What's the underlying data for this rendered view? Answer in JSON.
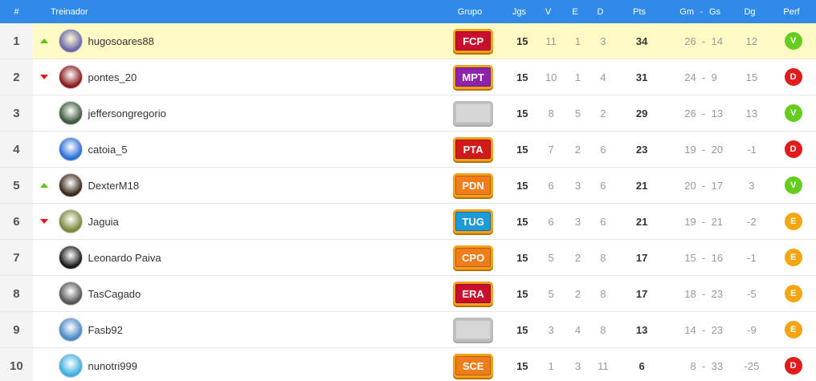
{
  "header": {
    "pos": "#",
    "coach": "Treinador",
    "group": "Grupo",
    "jgs": "Jgs",
    "v": "V",
    "e": "E",
    "d": "D",
    "pts": "Pts",
    "gm": "Gm",
    "dash": "-",
    "gs": "Gs",
    "dg": "Dg",
    "perf": "Perf"
  },
  "colors": {
    "header_bg": "#2f8ae8",
    "highlight_row": "#fff9c4",
    "perf_V": "#66cc1f",
    "perf_D": "#e31b1b",
    "perf_E": "#f5a512"
  },
  "rows": [
    {
      "pos": "1",
      "trend": "up",
      "name": "hugosoares88",
      "avatar_color": "#6a6aa8",
      "group": "FCP",
      "group_color": "#c8102e",
      "jgs": "15",
      "v": "11",
      "e": "1",
      "d": "3",
      "pts": "34",
      "gm": "26",
      "dash": "-",
      "gs": "14",
      "dg": "12",
      "perf": "V",
      "highlight": true
    },
    {
      "pos": "2",
      "trend": "down",
      "name": "pontes_20",
      "avatar_color": "#8b1a1a",
      "group": "MPT",
      "group_color": "#8e24aa",
      "jgs": "15",
      "v": "10",
      "e": "1",
      "d": "4",
      "pts": "31",
      "gm": "24",
      "dash": "-",
      "gs": "9",
      "dg": "15",
      "perf": "D"
    },
    {
      "pos": "3",
      "trend": "",
      "name": "jeffersongregorio",
      "avatar_color": "#3d5a3d",
      "group": "",
      "group_color": "",
      "jgs": "15",
      "v": "8",
      "e": "5",
      "d": "2",
      "pts": "29",
      "gm": "26",
      "dash": "-",
      "gs": "13",
      "dg": "13",
      "perf": "V"
    },
    {
      "pos": "4",
      "trend": "",
      "name": "catoia_5",
      "avatar_color": "#2a6fd6",
      "group": "PTA",
      "group_color": "#d21a1a",
      "jgs": "15",
      "v": "7",
      "e": "2",
      "d": "6",
      "pts": "23",
      "gm": "19",
      "dash": "-",
      "gs": "20",
      "dg": "-1",
      "perf": "D"
    },
    {
      "pos": "5",
      "trend": "up",
      "name": "DexterM18",
      "avatar_color": "#3b2a1a",
      "group": "PDN",
      "group_color": "#f07c1a",
      "jgs": "15",
      "v": "6",
      "e": "3",
      "d": "6",
      "pts": "21",
      "gm": "20",
      "dash": "-",
      "gs": "17",
      "dg": "3",
      "perf": "V"
    },
    {
      "pos": "6",
      "trend": "down",
      "name": "Jaguia",
      "avatar_color": "#7a8a3a",
      "group": "TUG",
      "group_color": "#1e9bd7",
      "jgs": "15",
      "v": "6",
      "e": "3",
      "d": "6",
      "pts": "21",
      "gm": "19",
      "dash": "-",
      "gs": "21",
      "dg": "-2",
      "perf": "E"
    },
    {
      "pos": "7",
      "trend": "",
      "name": "Leonardo Paiva",
      "avatar_color": "#1a1a1a",
      "group": "CPO",
      "group_color": "#f07c1a",
      "jgs": "15",
      "v": "5",
      "e": "2",
      "d": "8",
      "pts": "17",
      "gm": "15",
      "dash": "-",
      "gs": "16",
      "dg": "-1",
      "perf": "E"
    },
    {
      "pos": "8",
      "trend": "",
      "name": "TasCagado",
      "avatar_color": "#555555",
      "group": "ERA",
      "group_color": "#c8102e",
      "jgs": "15",
      "v": "5",
      "e": "2",
      "d": "8",
      "pts": "17",
      "gm": "18",
      "dash": "-",
      "gs": "23",
      "dg": "-5",
      "perf": "E"
    },
    {
      "pos": "9",
      "trend": "",
      "name": "Fasb92",
      "avatar_color": "#4a8ac8",
      "group": "",
      "group_color": "",
      "jgs": "15",
      "v": "3",
      "e": "4",
      "d": "8",
      "pts": "13",
      "gm": "14",
      "dash": "-",
      "gs": "23",
      "dg": "-9",
      "perf": "E"
    },
    {
      "pos": "10",
      "trend": "",
      "name": "nunotri999",
      "avatar_color": "#3cb0e0",
      "group": "SCE",
      "group_color": "#f07c1a",
      "jgs": "15",
      "v": "1",
      "e": "3",
      "d": "11",
      "pts": "6",
      "gm": "8",
      "dash": "-",
      "gs": "33",
      "dg": "-25",
      "perf": "D"
    }
  ]
}
